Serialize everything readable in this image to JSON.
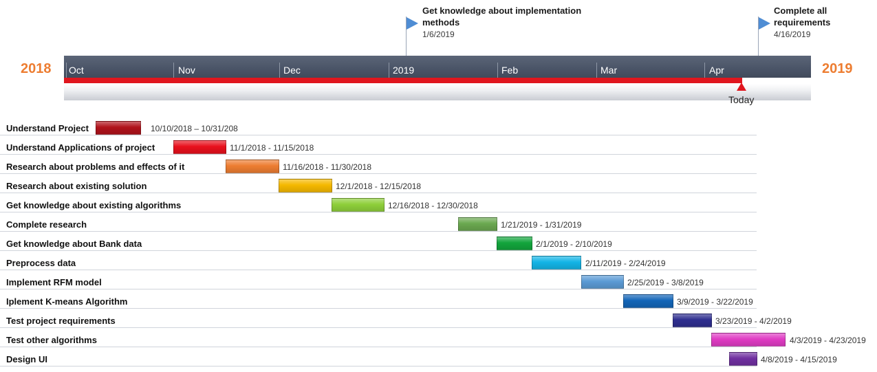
{
  "chart_data": {
    "type": "gantt",
    "years": {
      "left": "2018",
      "right": "2019"
    },
    "months": [
      "Oct",
      "Nov",
      "Dec",
      "2019",
      "Feb",
      "Mar",
      "Apr"
    ],
    "today_label": "Today",
    "milestones": [
      {
        "title_lines": [
          "Get knowledge about implementation",
          "methods"
        ],
        "date": "1/6/2019"
      },
      {
        "title_lines": [
          "Complete all",
          "requirements"
        ],
        "date": "4/16/2019"
      }
    ],
    "tasks": [
      {
        "name": "Understand Project",
        "range_label": "10/10/2018 – 10/31/208",
        "color": "#b0121b"
      },
      {
        "name": "Understand Applications of project",
        "range_label": "11/1/2018 - 11/15/2018",
        "color": "#e8101c"
      },
      {
        "name": "Research about problems and effects of it",
        "range_label": "11/16/2018 - 11/30/2018",
        "color": "#ed7d31"
      },
      {
        "name": "Research about existing solution",
        "range_label": "12/1/2018 - 12/15/2018",
        "color": "#f5b800"
      },
      {
        "name": "Get knowledge about existing algorithms",
        "range_label": "12/16/2018 - 12/30/2018",
        "color": "#8ecf3a"
      },
      {
        "name": "Complete research",
        "range_label": "1/21/2019 - 1/31/2019",
        "color": "#6aa84f"
      },
      {
        "name": "Get knowledge about Bank data",
        "range_label": "2/1/2019 - 2/10/2019",
        "color": "#12a53c"
      },
      {
        "name": "Preprocess data",
        "range_label": "2/11/2019 - 2/24/2019",
        "color": "#14b4e6"
      },
      {
        "name": "Implement RFM model",
        "range_label": "2/25/2019 - 3/8/2019",
        "color": "#5b9bd5"
      },
      {
        "name": "Iplement K-means Algorithm",
        "range_label": "3/9/2019 - 3/22/2019",
        "color": "#1265b8"
      },
      {
        "name": "Test project requirements",
        "range_label": "3/23/2019 - 4/2/2019",
        "color": "#2e2e8f"
      },
      {
        "name": "Test other algorithms",
        "range_label": "4/3/2019 - 4/23/2019",
        "color": "#e03cc4"
      },
      {
        "name": "Design UI",
        "range_label": "4/8/2019 - 4/15/2019",
        "color": "#7030a0"
      }
    ]
  }
}
